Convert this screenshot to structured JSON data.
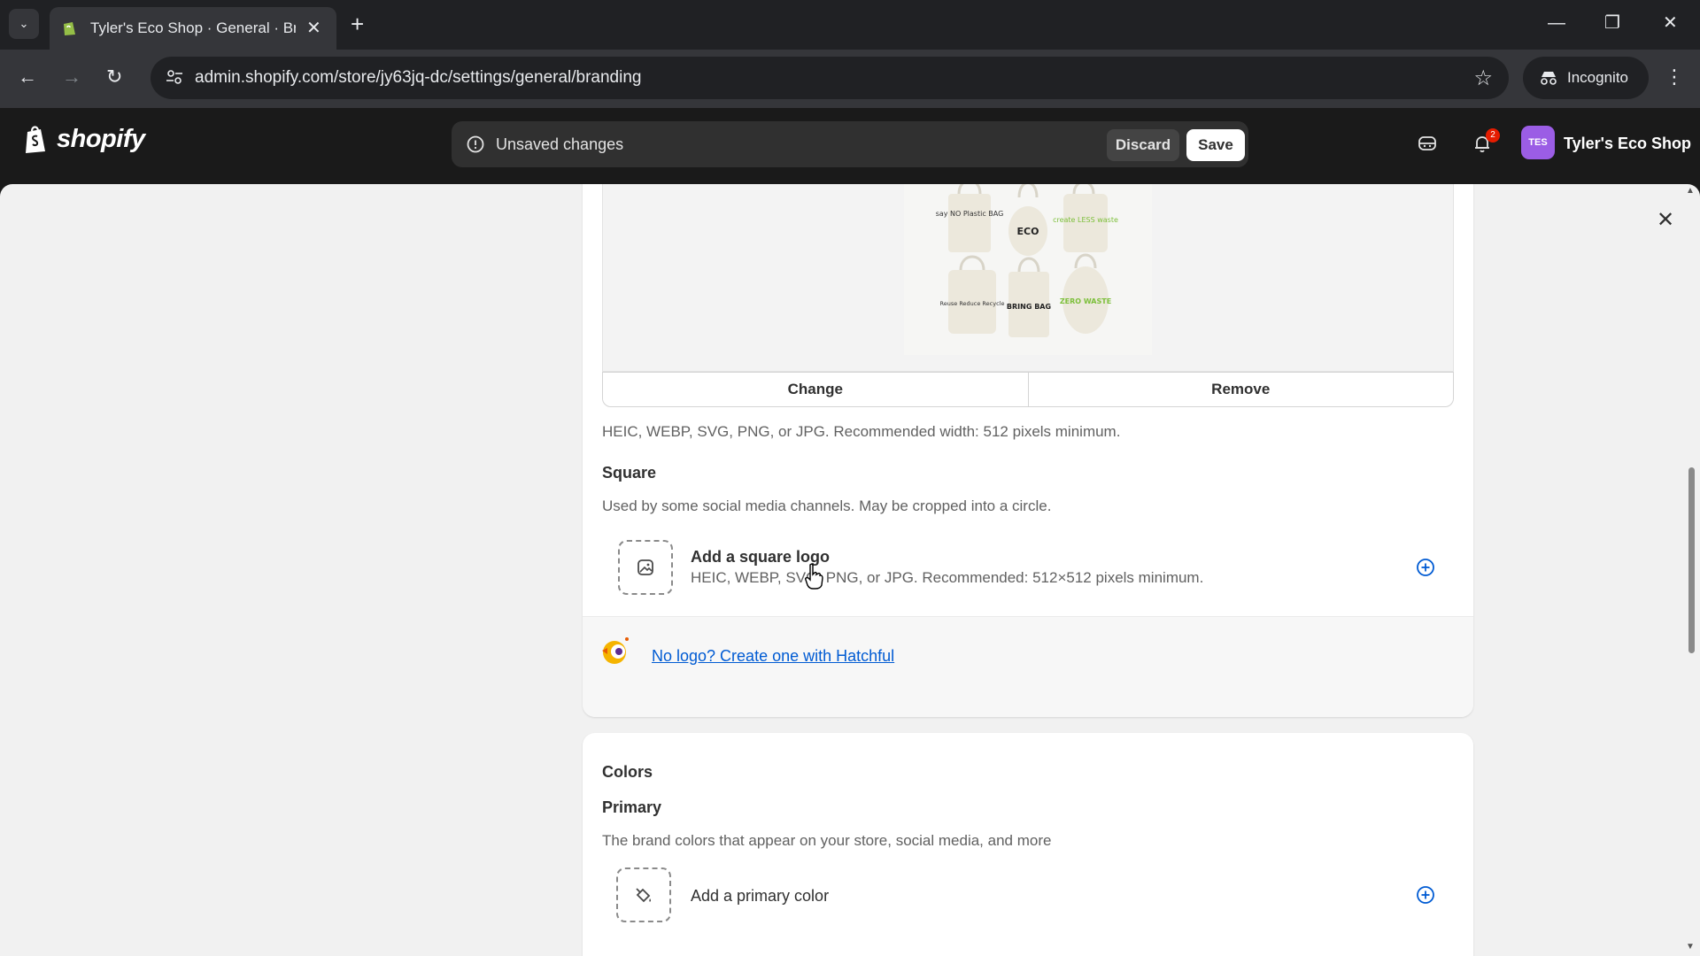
{
  "browser": {
    "tab_title": "Tyler's Eco Shop · General · Branding",
    "url": "admin.shopify.com/store/jy63jq-dc/settings/general/branding",
    "incognito_label": "Incognito"
  },
  "topbar": {
    "logo_text": "shopify",
    "unsaved_text": "Unsaved changes",
    "discard_label": "Discard",
    "save_label": "Save",
    "notification_count": "2",
    "avatar_initials": "TES",
    "store_name": "Tyler's Eco Shop"
  },
  "logo_section": {
    "change_label": "Change",
    "remove_label": "Remove",
    "format_hint": "HEIC, WEBP, SVG, PNG, or JPG. Recommended width: 512 pixels minimum.",
    "bag_texts": [
      "say NO Plastic BAG",
      "ECO",
      "create LESS waste",
      "Reuse Reduce Recycle",
      "BRING BAG",
      "ZERO WASTE"
    ]
  },
  "square_section": {
    "heading": "Square",
    "description": "Used by some social media channels. May be cropped into a circle.",
    "add_title": "Add a square logo",
    "add_hint": "HEIC, WEBP, SVG, PNG, or JPG. Recommended: 512×512 pixels minimum."
  },
  "hatchful": {
    "link_text": "No logo? Create one with Hatchful"
  },
  "colors_section": {
    "heading": "Colors",
    "subheading": "Primary",
    "description": "The brand colors that appear on your store, social media, and more",
    "add_label": "Add a primary color"
  },
  "colors": {
    "accent_blue": "#005bd3",
    "brand_green": "#95bf47",
    "bag_green": "#7cbf3a"
  }
}
